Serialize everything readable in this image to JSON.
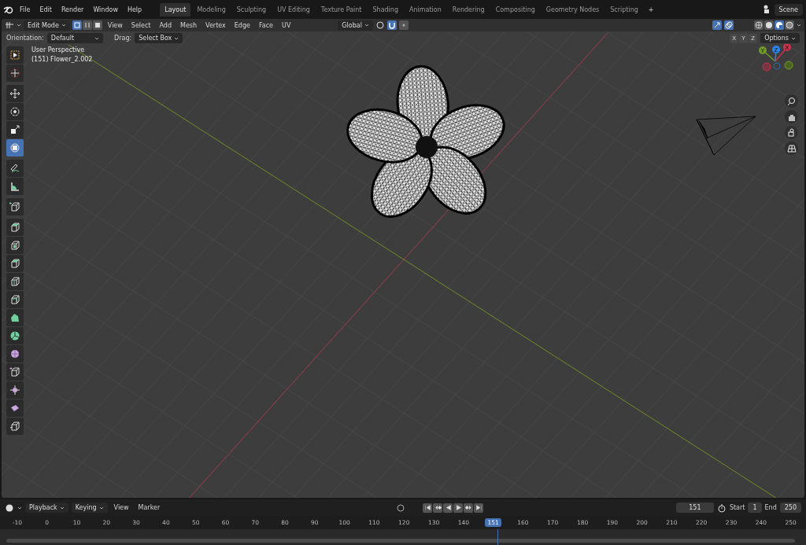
{
  "topbar": {
    "menus": [
      "File",
      "Edit",
      "Render",
      "Window",
      "Help"
    ],
    "workspaces": [
      {
        "label": "Layout",
        "selected": true
      },
      {
        "label": "Modeling",
        "selected": false
      },
      {
        "label": "Sculpting",
        "selected": false
      },
      {
        "label": "UV Editing",
        "selected": false
      },
      {
        "label": "Texture Paint",
        "selected": false
      },
      {
        "label": "Shading",
        "selected": false
      },
      {
        "label": "Animation",
        "selected": false
      },
      {
        "label": "Rendering",
        "selected": false
      },
      {
        "label": "Compositing",
        "selected": false
      },
      {
        "label": "Geometry Nodes",
        "selected": false
      },
      {
        "label": "Scripting",
        "selected": false
      }
    ],
    "add_tab": "+",
    "scene": "Scene"
  },
  "header": {
    "mode": "Edit Mode",
    "select_modes": [
      {
        "kind": "vertex",
        "selected": true
      },
      {
        "kind": "edge",
        "selected": false
      },
      {
        "kind": "face",
        "selected": false
      }
    ],
    "menus": [
      "View",
      "Select",
      "Add",
      "Mesh",
      "Vertex",
      "Edge",
      "Face",
      "UV"
    ],
    "orientation": "Global",
    "snap": {
      "on": true
    },
    "proportional": {
      "on": false
    },
    "gizmo": {
      "on": true
    },
    "overlays": {
      "on": true
    },
    "shading": [
      {
        "kind": "wireframe",
        "selected": false
      },
      {
        "kind": "solid",
        "selected": false
      },
      {
        "kind": "material",
        "selected": true
      },
      {
        "kind": "rendered",
        "selected": false
      }
    ]
  },
  "tool_settings": {
    "orientation_label": "Orientation:",
    "orientation": "Default",
    "drag_label": "Drag:",
    "drag": "Select Box",
    "axes": [
      {
        "label": "X",
        "on": false
      },
      {
        "label": "Y",
        "on": false
      },
      {
        "label": "Z",
        "on": false
      }
    ],
    "options": "Options"
  },
  "viewport": {
    "view_name": "User Perspective",
    "object": "(151) Flower_2.002",
    "gizmo_axes": [
      {
        "label": "Y",
        "color": "#6f9a2a"
      },
      {
        "label": "Z",
        "color": "#2d84e8"
      },
      {
        "label": "X",
        "color": "#c8334a"
      }
    ]
  },
  "toolbar": {
    "groups": [
      {
        "tools": [
          {
            "kind": "select",
            "selected": false
          },
          {
            "kind": "cursor",
            "selected": false
          }
        ]
      },
      {
        "tools": [
          {
            "kind": "move",
            "selected": false
          },
          {
            "kind": "rotate",
            "selected": false
          },
          {
            "kind": "scale",
            "selected": false
          },
          {
            "kind": "transform",
            "selected": true
          }
        ]
      },
      {
        "tools": [
          {
            "kind": "annotate",
            "selected": false
          },
          {
            "kind": "measure",
            "selected": false
          }
        ]
      },
      {
        "tools": [
          {
            "kind": "add-cube",
            "selected": false
          }
        ]
      },
      {
        "tools": [
          {
            "kind": "extrude",
            "selected": false
          },
          {
            "kind": "inset",
            "selected": false
          },
          {
            "kind": "bevel",
            "selected": false
          },
          {
            "kind": "loop-cut",
            "selected": false
          },
          {
            "kind": "knife",
            "selected": false
          },
          {
            "kind": "poly-build",
            "selected": false
          },
          {
            "kind": "spin",
            "selected": false
          },
          {
            "kind": "smooth",
            "selected": false
          },
          {
            "kind": "edge-slide",
            "selected": false
          },
          {
            "kind": "shrink",
            "selected": false
          },
          {
            "kind": "shear",
            "selected": false
          },
          {
            "kind": "rip",
            "selected": false
          }
        ]
      }
    ]
  },
  "timeline": {
    "menus": [
      {
        "label": "Playback",
        "kind": "dropdown"
      },
      {
        "label": "Keying",
        "kind": "dropdown"
      },
      {
        "label": "View",
        "kind": "menu"
      },
      {
        "label": "Marker",
        "kind": "menu"
      }
    ],
    "current_frame": "151",
    "start_label": "Start",
    "start": "1",
    "end_label": "End",
    "end": "250",
    "ruler": [
      {
        "label": "-10",
        "selected": false
      },
      {
        "label": "0",
        "selected": false
      },
      {
        "label": "10",
        "selected": false
      },
      {
        "label": "20",
        "selected": false
      },
      {
        "label": "30",
        "selected": false
      },
      {
        "label": "40",
        "selected": false
      },
      {
        "label": "50",
        "selected": false
      },
      {
        "label": "60",
        "selected": false
      },
      {
        "label": "70",
        "selected": false
      },
      {
        "label": "80",
        "selected": false
      },
      {
        "label": "90",
        "selected": false
      },
      {
        "label": "100",
        "selected": false
      },
      {
        "label": "110",
        "selected": false
      },
      {
        "label": "120",
        "selected": false
      },
      {
        "label": "130",
        "selected": false
      },
      {
        "label": "140",
        "selected": false
      },
      {
        "label": "151",
        "selected": true
      },
      {
        "label": "160",
        "selected": false
      },
      {
        "label": "170",
        "selected": false
      },
      {
        "label": "180",
        "selected": false
      },
      {
        "label": "190",
        "selected": false
      },
      {
        "label": "200",
        "selected": false
      },
      {
        "label": "210",
        "selected": false
      },
      {
        "label": "220",
        "selected": false
      },
      {
        "label": "230",
        "selected": false
      },
      {
        "label": "240",
        "selected": false
      },
      {
        "label": "250",
        "selected": false
      }
    ]
  }
}
